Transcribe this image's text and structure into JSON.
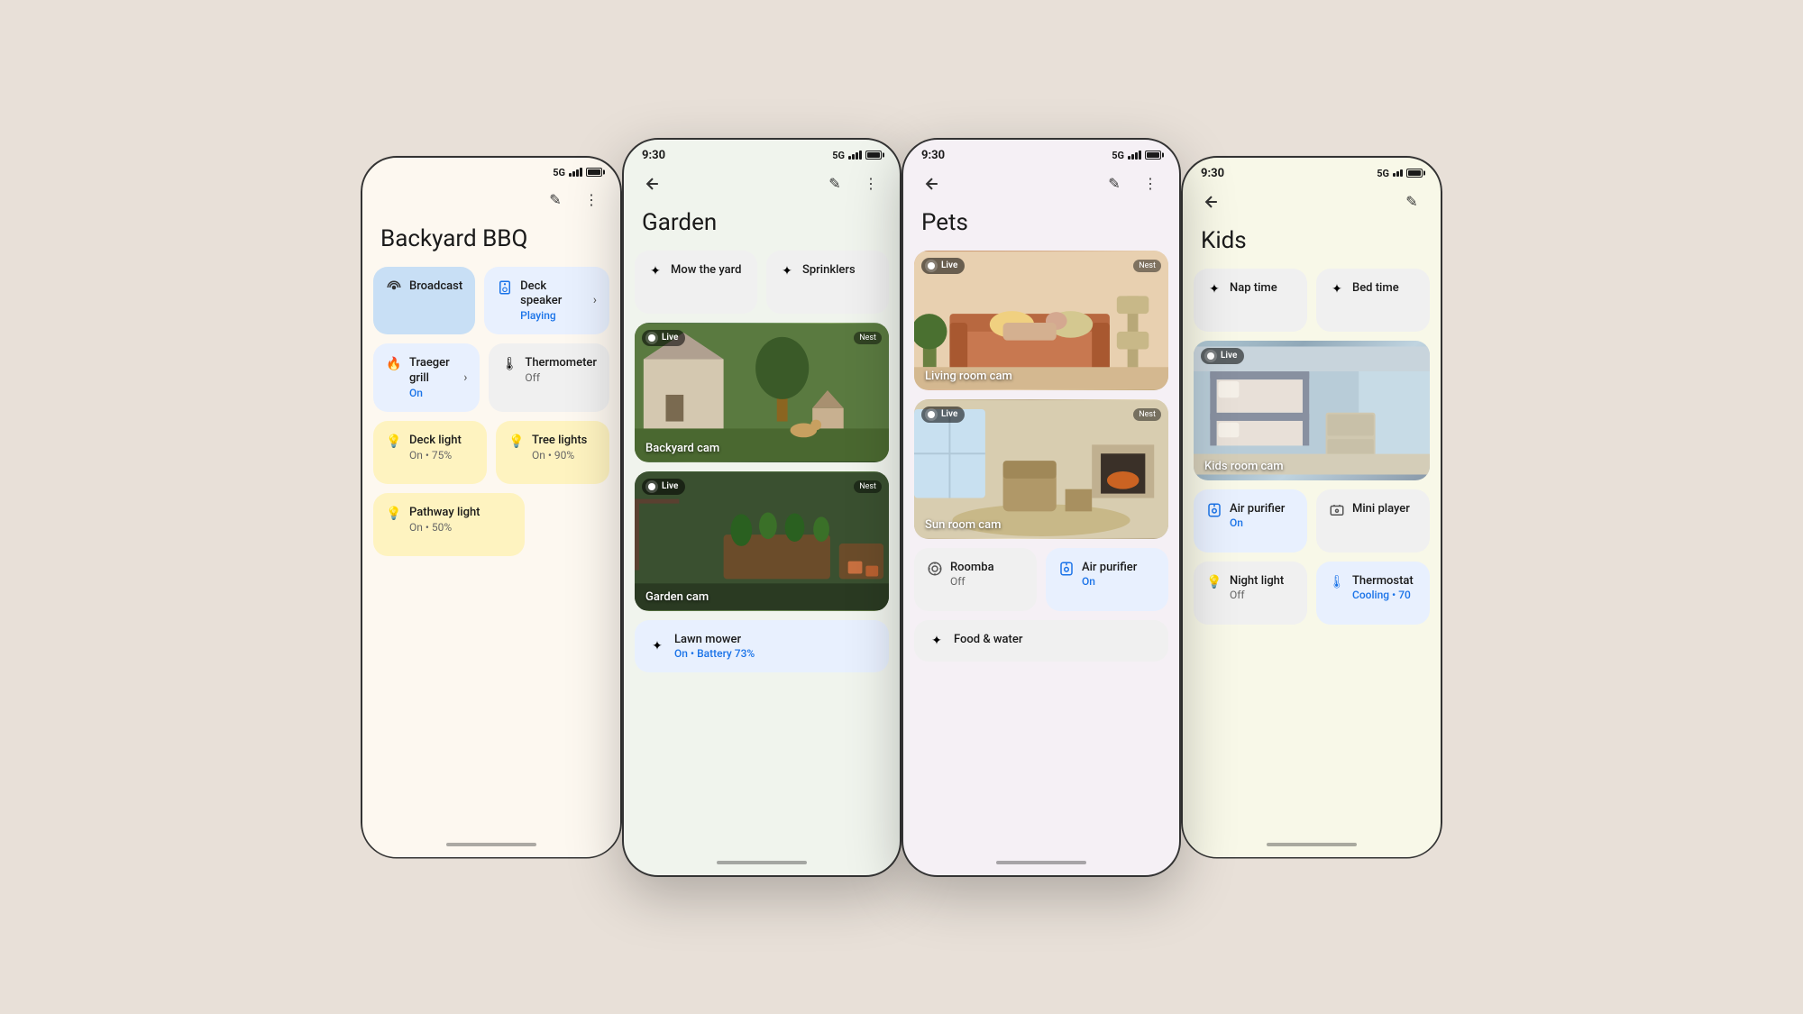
{
  "phones": [
    {
      "id": "bbq",
      "title": "Backyard BBQ",
      "status_time": "",
      "status_5g": "5G",
      "bg_color": "#fdf8f0",
      "header_bg": "#fdf8f0",
      "partial": "left",
      "items": [
        {
          "type": "row2",
          "cards": [
            {
              "name": "Broadcast",
              "icon": "broadcast",
              "status": "",
              "color": "blue-light",
              "wide": true
            },
            {
              "name": "Deck speaker",
              "icon": "speaker",
              "status": "Playing",
              "color": "blue-light"
            }
          ]
        },
        {
          "type": "row2",
          "cards": [
            {
              "name": "Traeger grill",
              "icon": "grill",
              "status": "On",
              "color": "blue-light",
              "arrow": true
            },
            {
              "name": "Thermometer",
              "icon": "thermo",
              "status": "Off",
              "color": "white"
            }
          ]
        },
        {
          "type": "row2",
          "cards": [
            {
              "name": "Deck light",
              "icon": "bulb",
              "status": "On • 75%",
              "color": "yellow"
            },
            {
              "name": "Tree lights",
              "icon": "bulb",
              "status": "On • 90%",
              "color": "yellow"
            }
          ]
        },
        {
          "type": "row1",
          "cards": [
            {
              "name": "Pathway light",
              "icon": "bulb",
              "status": "On • 50%",
              "color": "yellow"
            }
          ]
        }
      ]
    },
    {
      "id": "garden",
      "title": "Garden",
      "status_time": "9:30",
      "status_5g": "5G",
      "bg_color": "#f0f4ed",
      "header_bg": "#f0f4ed",
      "partial": "none",
      "items": [
        {
          "type": "row2-action",
          "cards": [
            {
              "name": "Mow the yard",
              "icon": "sparkle",
              "color": "white"
            },
            {
              "name": "Sprinklers",
              "icon": "sparkle",
              "color": "white"
            }
          ]
        },
        {
          "type": "camera",
          "name": "Backyard cam",
          "label": "backyard",
          "cam_id": "backyard"
        },
        {
          "type": "camera",
          "name": "Garden cam",
          "label": "garden",
          "cam_id": "garden"
        },
        {
          "type": "row1-full",
          "cards": [
            {
              "name": "Lawn mower",
              "icon": "sparkle",
              "status": "On • Battery 73%",
              "color": "blue-light"
            }
          ]
        }
      ]
    },
    {
      "id": "pets",
      "title": "Pets",
      "status_time": "9:30",
      "status_5g": "5G",
      "bg_color": "#f5f0f5",
      "header_bg": "#f5f0f5",
      "partial": "none",
      "items": [
        {
          "type": "camera",
          "name": "Living room cam",
          "label": "living",
          "cam_id": "living"
        },
        {
          "type": "camera",
          "name": "Sun room cam",
          "label": "sun",
          "cam_id": "sun"
        },
        {
          "type": "row2-device",
          "cards": [
            {
              "name": "Roomba",
              "icon": "roomba",
              "status": "Off",
              "color": "white"
            },
            {
              "name": "Air purifier",
              "icon": "purifier",
              "status": "On",
              "color": "blue-light",
              "status_color": "blue"
            }
          ]
        },
        {
          "type": "row1-full",
          "cards": [
            {
              "name": "Food & water",
              "icon": "sparkle",
              "color": "white"
            }
          ]
        }
      ]
    },
    {
      "id": "kids",
      "title": "Kids",
      "status_time": "9:30",
      "status_5g": "5G",
      "bg_color": "#f8f8e8",
      "header_bg": "#f8f8e8",
      "partial": "right",
      "items": [
        {
          "type": "row2-action",
          "cards": [
            {
              "name": "Nap time",
              "icon": "sparkle",
              "color": "white"
            },
            {
              "name": "Bed time",
              "icon": "sparkle",
              "color": "white"
            }
          ]
        },
        {
          "type": "camera",
          "name": "Kids room cam",
          "label": "kids",
          "cam_id": "kids"
        },
        {
          "type": "row2-device",
          "cards": [
            {
              "name": "Air purifier",
              "icon": "purifier",
              "status": "On",
              "color": "blue-light",
              "status_color": "blue"
            },
            {
              "name": "Mini player",
              "icon": "mini-player",
              "status": "",
              "color": "white"
            }
          ]
        },
        {
          "type": "row2-device",
          "cards": [
            {
              "name": "Night light",
              "icon": "bulb",
              "status": "Off",
              "color": "white"
            },
            {
              "name": "Thermostat",
              "icon": "thermo-blue",
              "status": "Cooling • 70",
              "color": "blue-light",
              "status_color": "blue"
            }
          ]
        }
      ]
    }
  ],
  "labels": {
    "live": "Live",
    "nest": "Nest",
    "back_arrow": "←",
    "edit_icon": "✎",
    "more_icon": "⋮"
  }
}
